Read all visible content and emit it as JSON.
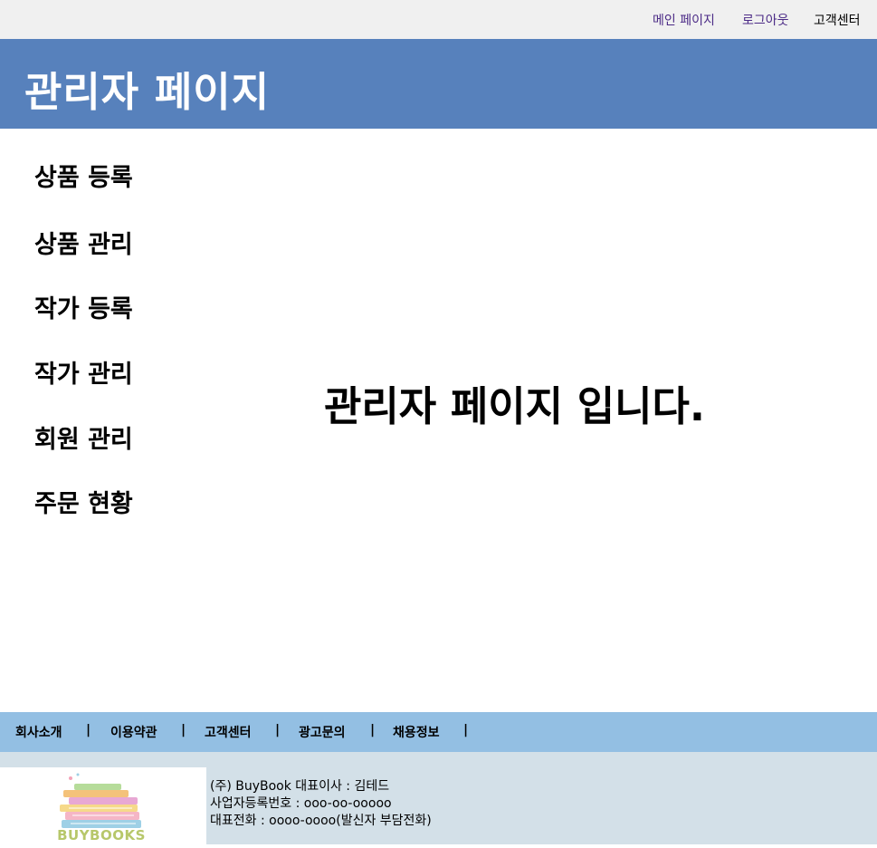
{
  "topbar": {
    "main_page": "메인 페이지",
    "logout": "로그아웃",
    "customer_center": "고객센터"
  },
  "header": {
    "title": "관리자 페이지"
  },
  "sidebar": {
    "items": [
      {
        "label": "상품 등록"
      },
      {
        "label": "상품 관리"
      },
      {
        "label": "작가 등록"
      },
      {
        "label": "작가 관리"
      },
      {
        "label": "회원 관리"
      },
      {
        "label": "주문 현황"
      }
    ]
  },
  "main": {
    "welcome": "관리자 페이지 입니다."
  },
  "footer": {
    "links": [
      {
        "label": "회사소개"
      },
      {
        "label": "이용약관"
      },
      {
        "label": "고객센터"
      },
      {
        "label": "광고문의"
      },
      {
        "label": "채용정보"
      }
    ],
    "separator": "|",
    "logo_text": "BUYBOOKS",
    "company": {
      "line1": "(주) BuyBook 대표이사 : 김테드",
      "line2": "사업자등록번호 : ooo-oo-ooooo",
      "line3": "대표전화 : oooo-oooo(발신자 부담전화)"
    }
  },
  "colors": {
    "header_bg": "#5781bc",
    "footer_links_bg": "#93bfe3",
    "footer_info_bg": "#d3e0e8",
    "topbar_bg": "#f0f0f0",
    "visited_link": "#4b2a86"
  }
}
